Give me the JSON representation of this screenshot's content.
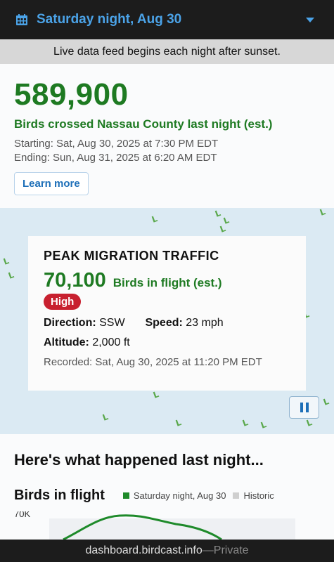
{
  "header": {
    "date_label": "Saturday night, Aug 30",
    "accent": "#4ba3e8"
  },
  "notice": {
    "text": "Live data feed begins each night after sunset."
  },
  "summary": {
    "count": "589,900",
    "description": "Birds crossed Nassau County last night (est.)",
    "starting": "Starting: Sat, Aug 30, 2025 at 7:30 PM EDT",
    "ending": "Ending: Sun, Aug 31, 2025 at 6:20 AM EDT",
    "learn_more": "Learn more"
  },
  "peak": {
    "title": "PEAK MIGRATION TRAFFIC",
    "count": "70,100",
    "count_label": "Birds in flight (est.)",
    "intensity": "High",
    "direction_label": "Direction:",
    "direction_value": "SSW",
    "speed_label": "Speed:",
    "speed_value": "23 mph",
    "altitude_label": "Altitude:",
    "altitude_value": "2,000 ft",
    "recorded": "Recorded: Sat, Aug 30, 2025 at 11:20 PM EDT"
  },
  "lower": {
    "section_heading": "Here's what happened last night...",
    "chart_title": "Birds in flight",
    "legend": [
      {
        "label": "Saturday night, Aug 30",
        "color": "#1e8a2a"
      },
      {
        "label": "Historic",
        "color": "#cfcfcf"
      }
    ],
    "y_tick": "70K"
  },
  "browser": {
    "domain": "dashboard.birdcast.info",
    "separator": " — ",
    "privacy": "Private"
  },
  "colors": {
    "green": "#1e7a22",
    "badge_red": "#c8202f",
    "map_bg": "#dbeaf3"
  }
}
